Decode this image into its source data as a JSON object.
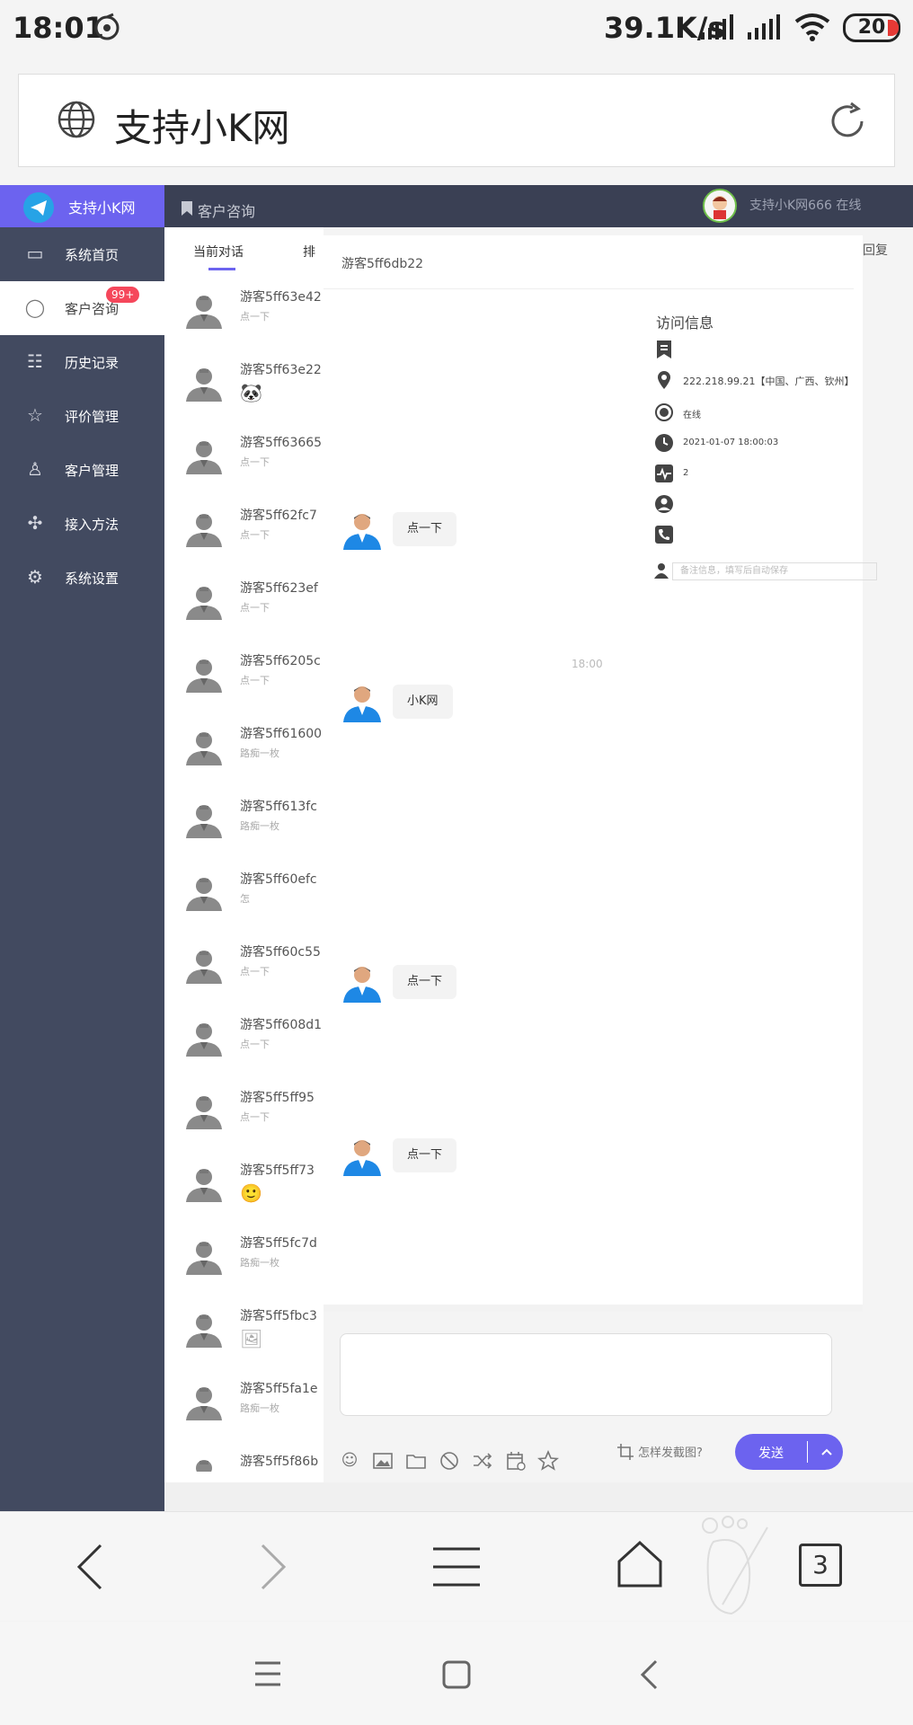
{
  "status_bar": {
    "time": "18:01",
    "net_speed": "39.1K/s",
    "battery": "20"
  },
  "browser": {
    "address_title": "支持小K网",
    "tab_count": "3"
  },
  "app": {
    "logo": "支持小K网",
    "header_title": "客户咨询",
    "user_status": "支持小K网666 在线",
    "colors": {
      "accent": "#6c63ef",
      "sidebar": "#424a60",
      "topbar": "#3a4054",
      "badge": "#f5475b",
      "agent_avatar": "#1e88e5"
    }
  },
  "sidebar": {
    "items": [
      {
        "label": "系统首页",
        "icon": "browser-window-icon"
      },
      {
        "label": "客户咨询",
        "icon": "chat-bubble-icon",
        "badge": "99+",
        "active": true
      },
      {
        "label": "历史记录",
        "icon": "calendar-list-icon"
      },
      {
        "label": "评价管理",
        "icon": "star-icon"
      },
      {
        "label": "客户管理",
        "icon": "user-icon"
      },
      {
        "label": "接入方法",
        "icon": "puzzle-icon"
      },
      {
        "label": "系统设置",
        "icon": "gear-icon"
      }
    ]
  },
  "conversation_list": {
    "tabs": [
      "当前对话",
      "排"
    ],
    "items": [
      {
        "name": "游客5ff63e42",
        "preview": "点一下"
      },
      {
        "name": "游客5ff63e22",
        "preview": "🐼"
      },
      {
        "name": "游客5ff63665",
        "preview": "点一下"
      },
      {
        "name": "游客5ff62fc7",
        "preview": "点一下"
      },
      {
        "name": "游客5ff623ef",
        "preview": "点一下"
      },
      {
        "name": "游客5ff6205c",
        "preview": "点一下"
      },
      {
        "name": "游客5ff61600",
        "preview": "路痴一枚"
      },
      {
        "name": "游客5ff613fc",
        "preview": "路痴一枚"
      },
      {
        "name": "游客5ff60efc",
        "preview": "怎"
      },
      {
        "name": "游客5ff60c55",
        "preview": "点一下"
      },
      {
        "name": "游客5ff608d1",
        "preview": "点一下"
      },
      {
        "name": "游客5ff5ff95",
        "preview": "点一下"
      },
      {
        "name": "游客5ff5ff73",
        "preview": "🙂"
      },
      {
        "name": "游客5ff5fc7d",
        "preview": "路痴一枚"
      },
      {
        "name": "游客5ff5fbc3",
        "preview": "🖼"
      },
      {
        "name": "游客5ff5fa1e",
        "preview": "路痴一枚"
      },
      {
        "name": "游客5ff5f86b",
        "preview": ""
      }
    ]
  },
  "chat": {
    "title": "游客5ff6db22",
    "reply_label": "回复",
    "messages": [
      {
        "text": "点一下"
      },
      {
        "text": "小K网"
      },
      {
        "text": "点一下"
      },
      {
        "text": "点一下"
      }
    ],
    "time_mark": "18:00",
    "crop_hint": "怎样发截图?",
    "send_label": "发送",
    "toolbar_icons": [
      "smiley-icon",
      "image-icon",
      "folder-icon",
      "ban-icon",
      "shuffle-icon",
      "calendar-icon",
      "star-icon"
    ]
  },
  "visitor_info": {
    "title": "访问信息",
    "ip": "222.218.99.21【中国、广西、钦州】",
    "status": "在线",
    "time": "2021-01-07 18:00:03",
    "visits": "2",
    "remark_placeholder": "备注信息，填写后自动保存"
  }
}
